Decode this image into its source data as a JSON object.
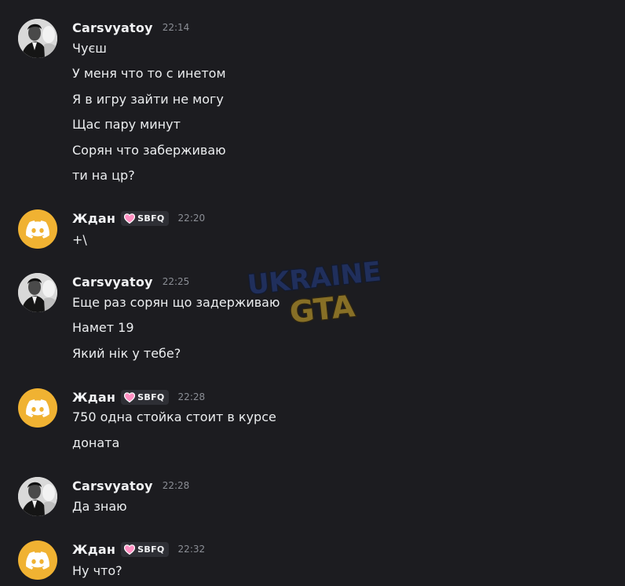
{
  "messages": [
    {
      "username": "Carsvyatoy",
      "time": "22:14",
      "avatar_icon": "user-photo-avatar",
      "lines": [
        "Чуєш",
        "У меня что то с инетом",
        "Я в игру зайти не могу",
        "Щас пару минут",
        "Сорян что заберживаю",
        "ти на цр?"
      ]
    },
    {
      "username": "Ждан",
      "tag": "SBFQ",
      "time": "22:20",
      "avatar_icon": "discord-logo-icon",
      "lines": [
        "+\\"
      ]
    },
    {
      "username": "Carsvyatoy",
      "time": "22:25",
      "avatar_icon": "user-photo-avatar",
      "lines": [
        "Еще раз сорян що задерживаю",
        "Намет 19",
        "Який нік у тебе?"
      ]
    },
    {
      "username": "Ждан",
      "tag": "SBFQ",
      "time": "22:28",
      "avatar_icon": "discord-logo-icon",
      "lines": [
        "750 одна стойка стоит в курсе",
        "доната"
      ]
    },
    {
      "username": "Carsvyatoy",
      "time": "22:28",
      "avatar_icon": "user-photo-avatar",
      "lines": [
        "Да знаю"
      ]
    },
    {
      "username": "Ждан",
      "tag": "SBFQ",
      "time": "22:32",
      "avatar_icon": "discord-logo-icon",
      "lines": [
        "Ну что?"
      ]
    }
  ],
  "watermark": {
    "line1": "UKRAINE",
    "line2": "GTA"
  },
  "colors": {
    "background": "#1c1c20",
    "discord_avatar": "#f0b232",
    "tag_bg": "#2e2f35",
    "watermark_blue": "#24408e",
    "watermark_yellow": "#e0b32c"
  }
}
